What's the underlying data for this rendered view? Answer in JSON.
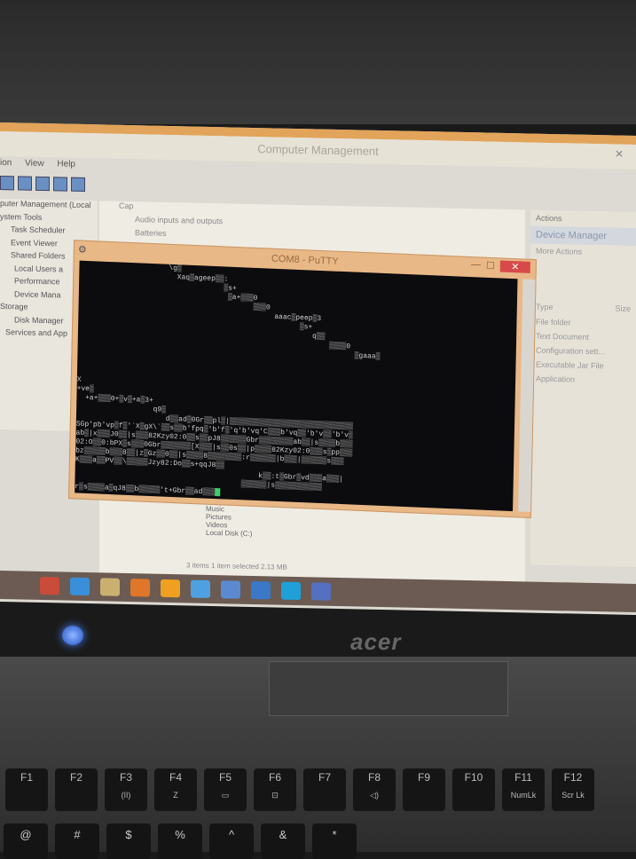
{
  "computer_management": {
    "title": "Computer Management",
    "menu": [
      "ion",
      "View",
      "Help"
    ],
    "tree": [
      "puter Management (Local",
      "ystem Tools",
      "Task Scheduler",
      "Event Viewer",
      "Shared Folders",
      "Local Users a",
      "Performance",
      "Device Mana",
      "Storage",
      "Disk Manager",
      "Services and App"
    ],
    "center_rows": [
      "Cap",
      "Audio inputs and outputs",
      "Batteries"
    ],
    "actions": {
      "header": "Actions",
      "selected": "Device Manager",
      "more": "More Actions",
      "columns": [
        "Type",
        "Size"
      ],
      "items": [
        "File folder",
        "Text Document",
        "Configuration sett...",
        "Executable Jar File",
        "Application"
      ]
    },
    "explorer_items": [
      "Music",
      "Pictures",
      "Videos",
      "Local Disk (C:)"
    ],
    "status": "3 items   1 item selected  2.13 MB"
  },
  "putty": {
    "title": "COM8 - PuTTY",
    "lines": [
      "                     \\g▒",
      "                       Xaq▒ageep▒▒:",
      "                                  ▒s+",
      "                                   ▒a+▒▒▒0",
      "                                         ▒▒▒0",
      "                                              aaac▒peep▒3",
      "                                                    ▒s+",
      "                                                       q▒▒",
      "                                                           ▒▒▒▒0",
      "                                                                 ▒gaaa▒",
      "",
      "",
      "",
      "X",
      "+ve▒",
      "  +a+▒▒▒0+▒v▒+a▒3+",
      "                  q9▒",
      "                     d▒▒ad▒0Gr▒▒pl▒|▒▒▒▒▒▒▒▒▒▒▒▒▒▒▒▒▒▒▒▒▒▒▒▒▒▒▒▒▒",
      "SGp'pb'vp▒f▒'`X▒gX\\`▒▒s▒▒b'fpq▒'b'f▒'q'b'vq'C▒▒▒b'vq▒▒'b'v▒▒'b'v▒",
      "ab▒|x▒▒▒J0▒▒|s▒▒▒82Kzy02:0▒▒s▒▒pJ8▒▒▒▒▒▒Gbr▒▒▒▒▒▒▒▒ab▒▒|s▒▒▒▒b▒▒▒",
      "02:O▒▒0:bPX▒s▒▒▒0Gbr▒▒▒▒▒▒▒[X▒▒▒|s▒▒0s▒▒|p▒▒▒▒82Kzy02:0▒▒▒s▒pp▒▒▒",
      "bz▒▒▒▒▒b▒▒▒8▒▒|z▒Gz▒▒0▒▒|s▒▒▒▒8▒▒▒▒▒▒▒▒:r▒▒▒▒▒▒|b▒▒▒|▒▒▒▒▒▒s▒▒▒",
      "K▒▒▒a▒▒PV▒▒\\▒▒▒▒▒Jzy82:Do▒▒s+qqJ8▒▒",
      "                                           k▒▒:t▒Gbr▒vd▒▒▒a▒▒▒|",
      "                                       ▒▒▒▒▒▒|s▒▒▒▒▒▒▒▒▒▒▒",
      "r▒s▒▒▒▒a▒qJ8▒▒b▒▒▒▒▒'t+Gbr▒▒ad▒▒▒"
    ]
  },
  "taskbar": {
    "icons": [
      "start-icon",
      "ie-icon",
      "explorer-icon",
      "media-icon",
      "firefox-icon",
      "chrome-icon",
      "network-icon",
      "folder-icon",
      "skype-icon",
      "paint-icon"
    ]
  },
  "laptop": {
    "brand": "acer",
    "fkeys": [
      "F1",
      "F2",
      "F3",
      "F4",
      "F5",
      "F6",
      "F7",
      "F8",
      "F9",
      "F10",
      "F11",
      "F12"
    ],
    "fkey_sub": [
      "",
      "",
      "(ǀǀ)",
      "Z",
      "▭",
      "⊡",
      "",
      "◁)",
      "",
      "",
      "NumLk",
      "Scr Lk"
    ],
    "num_row": [
      "@",
      "#",
      "$",
      "%",
      "^",
      "&",
      "*"
    ]
  },
  "colors": {
    "putty_frame": "#e9b887",
    "terminal_bg": "#0c0c0e",
    "cursor": "#3ad16a",
    "taskbar": "#6b5b52"
  }
}
